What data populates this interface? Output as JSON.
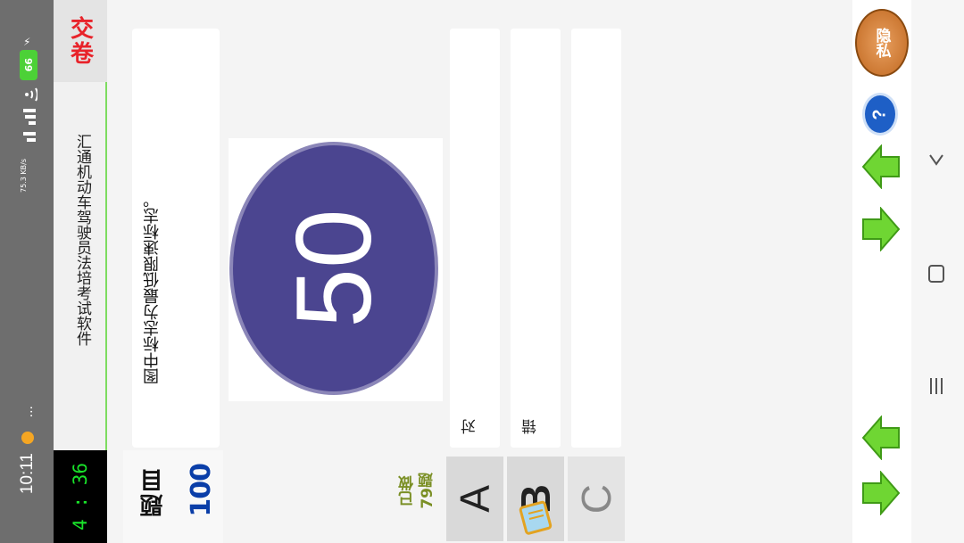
{
  "status_bar": {
    "time": "10:11",
    "dots": "...",
    "speed": "75.3 KB/s",
    "network": "5G 4G",
    "battery": "66"
  },
  "timer": {
    "minutes": "4",
    "seconds": "36",
    "display": "4 : 36"
  },
  "app": {
    "title": "汇通机动车驾驶员法培考试软件",
    "submit_label": "交卷"
  },
  "question": {
    "label": "题目",
    "number": "100",
    "text": "图中标志为最低限速标志。",
    "sign_value": "50"
  },
  "progress": {
    "done_label": "已做",
    "done_count": "79题"
  },
  "options": [
    {
      "letter": "A",
      "text": "对"
    },
    {
      "letter": "B",
      "text": "错"
    },
    {
      "letter": "C",
      "text": ""
    }
  ],
  "toolbar": {
    "privacy_label": "隐私"
  },
  "colors": {
    "accent_red": "#e8232a",
    "timer_green": "#19e32a",
    "sign_blue": "#4b4590",
    "number_blue": "#0a3ea8",
    "done_olive": "#7a8f24",
    "arrow_green": "#6fd633"
  }
}
